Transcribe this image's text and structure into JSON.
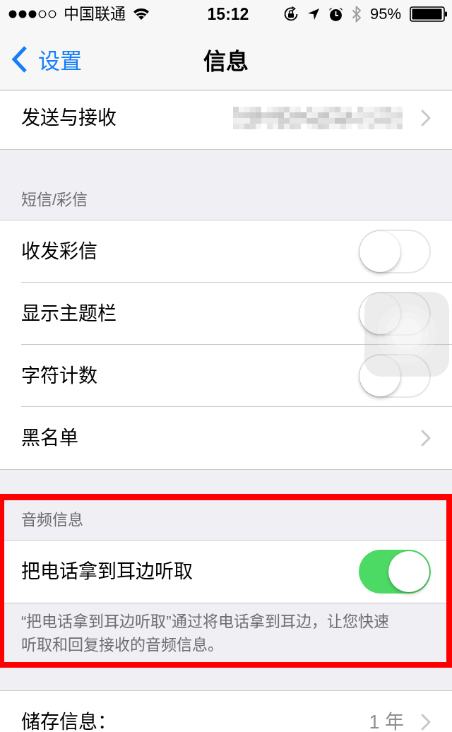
{
  "status_bar": {
    "carrier": "中国联通",
    "time": "15:12",
    "battery": "95%"
  },
  "nav": {
    "back": "设置",
    "title": "信息"
  },
  "sections": [
    {
      "highlighted": false,
      "rows": [
        {
          "kind": "link",
          "label": "发送与接收",
          "redacted": true
        }
      ]
    },
    {
      "header": "短信/彩信",
      "highlighted": false,
      "rows": [
        {
          "kind": "toggle",
          "label": "收发彩信",
          "on": false
        },
        {
          "kind": "toggle",
          "label": "显示主题栏",
          "on": false
        },
        {
          "kind": "toggle",
          "label": "字符计数",
          "on": false
        },
        {
          "kind": "link",
          "label": "黑名单",
          "redacted": false
        }
      ]
    },
    {
      "header": "音频信息",
      "highlighted": true,
      "rows": [
        {
          "kind": "toggle",
          "label": "把电话拿到耳边听取",
          "on": true
        }
      ],
      "footer": "“把电话拿到耳边听取”通过将电话拿到耳边，让您快速听取和回复接收的音频信息。"
    },
    {
      "highlighted": false,
      "rows": [
        {
          "kind": "link",
          "label": "储存信息：",
          "value": "1 年",
          "redacted": false
        }
      ]
    }
  ]
}
